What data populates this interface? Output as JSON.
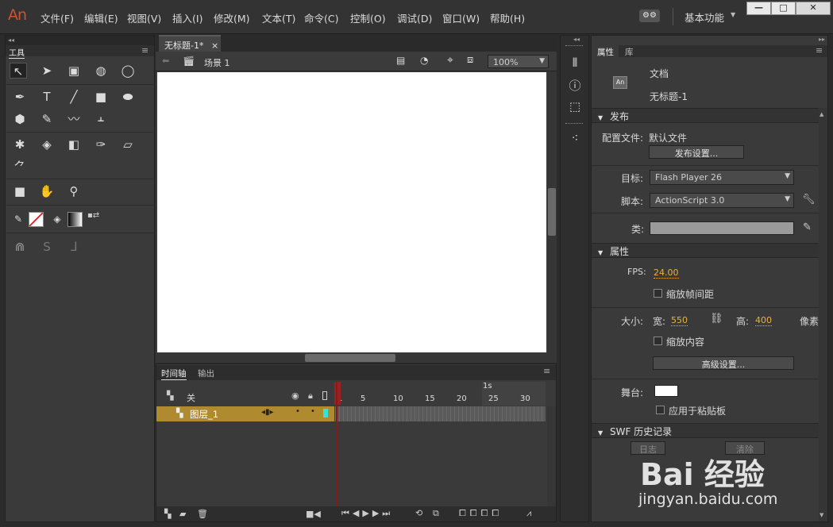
{
  "app": {
    "logo": "An"
  },
  "menu": [
    "文件(F)",
    "编辑(E)",
    "视图(V)",
    "插入(I)",
    "修改(M)",
    "文本(T)",
    "命令(C)",
    "控制(O)",
    "调试(D)",
    "窗口(W)",
    "帮助(H)"
  ],
  "workspace": {
    "icon": "⚙⚙",
    "label": "基本功能",
    "caret": "▼"
  },
  "window_buttons": {
    "minimize": "—",
    "maximize": "□",
    "close": "✕"
  },
  "tools_panel": {
    "title": "工具",
    "menu_icon": "≡"
  },
  "document": {
    "tab_title": "无标题-1*",
    "tab_close": "×",
    "scene_label": "场景 1",
    "zoom": "100%"
  },
  "timeline": {
    "tabs": [
      "时间轴",
      "输出"
    ],
    "header_label": "关",
    "layer_name": "图层_1",
    "second_marker": "1s",
    "frame_numbers": [
      "1",
      "5",
      "10",
      "15",
      "20",
      "25",
      "30"
    ]
  },
  "properties": {
    "tabs": [
      "属性",
      "库"
    ],
    "doc_icon_text": "An",
    "doc_type": "文档",
    "doc_name": "无标题-1",
    "publish": {
      "section": "发布",
      "profile_label": "配置文件:",
      "profile_value": "默认文件",
      "settings_button": "发布设置...",
      "target_label": "目标:",
      "target_value": "Flash Player 26",
      "script_label": "脚本:",
      "script_value": "ActionScript 3.0",
      "class_label": "类:"
    },
    "props": {
      "section": "属性",
      "fps_label": "FPS:",
      "fps_value": "24.00",
      "scale_spans": "缩放帧间距",
      "size_label": "大小:",
      "width_label": "宽:",
      "width_value": "550",
      "height_label": "高:",
      "height_value": "400",
      "unit": "像素",
      "scale_content": "缩放内容",
      "advanced_button": "高级设置...",
      "stage_label": "舞台:",
      "stage_color": "#ffffff",
      "apply_clipboard": "应用于粘贴板"
    },
    "swf": {
      "section": "SWF 历史记录",
      "log_button": "日志",
      "clear_button": "清除"
    }
  },
  "watermark": {
    "brand": "Bai 经验",
    "url": "jingyan.baidu.com"
  },
  "colors": {
    "accent_orange": "#e8b046",
    "layer_gold": "#b08a2e",
    "playhead_red": "#9b2020",
    "logo_red": "#d0512e"
  }
}
